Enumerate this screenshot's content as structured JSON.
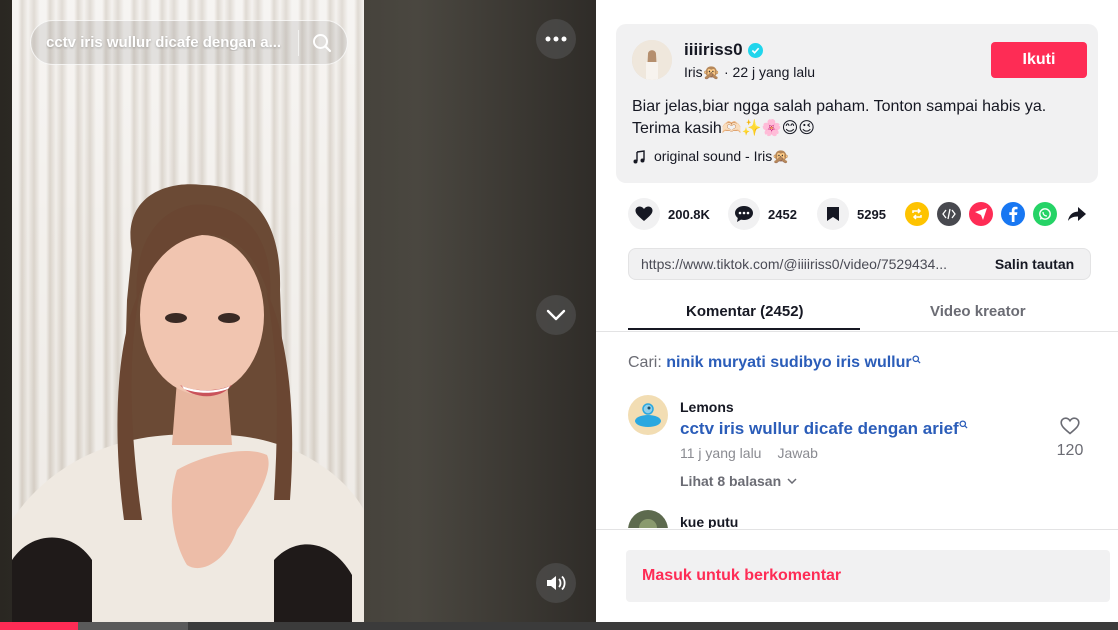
{
  "video": {
    "search_query": "cctv iris wullur dicafe dengan a...",
    "icons": {
      "search": "search-icon",
      "more": "more-icon",
      "down": "chevron-down-icon",
      "volume": "volume-icon"
    },
    "progress": 0.07
  },
  "author": {
    "username": "iiiiriss0",
    "verified": true,
    "display_name": "Iris🙊",
    "time_ago": "22 j yang lalu",
    "follow_label": "Ikuti"
  },
  "post": {
    "caption": "Biar jelas,biar ngga salah paham. Tonton sampai habis ya. Terima kasih🫶🏻✨🌸😊😉",
    "sound": "original sound - Iris🙊"
  },
  "stats": {
    "likes": "200.8K",
    "comments": "2452",
    "saves": "5295"
  },
  "share": {
    "icons": [
      "repost-icon",
      "embed-icon",
      "send-icon",
      "facebook-icon",
      "whatsapp-icon",
      "share-arrow-icon"
    ]
  },
  "link": {
    "url": "https://www.tiktok.com/@iiiiriss0/video/7529434...",
    "copy_label": "Salin tautan"
  },
  "tabs": {
    "comments": "Komentar (2452)",
    "creator_videos": "Video kreator"
  },
  "search_suggestion": {
    "prefix": "Cari:",
    "query": "ninik muryati sudibyo iris wullur"
  },
  "comments": [
    {
      "user": "Lemons",
      "text": "cctv iris wullur dicafe dengan arief",
      "time": "11 j yang lalu",
      "reply_label": "Jawab",
      "view_replies": "Lihat 8 balasan",
      "likes": "120"
    },
    {
      "user": "kue putu"
    }
  ],
  "login_prompt": "Masuk untuk berkomentar",
  "colors": {
    "brand": "#fe2c55",
    "link": "#2b5db9",
    "verified": "#20d5ec"
  }
}
